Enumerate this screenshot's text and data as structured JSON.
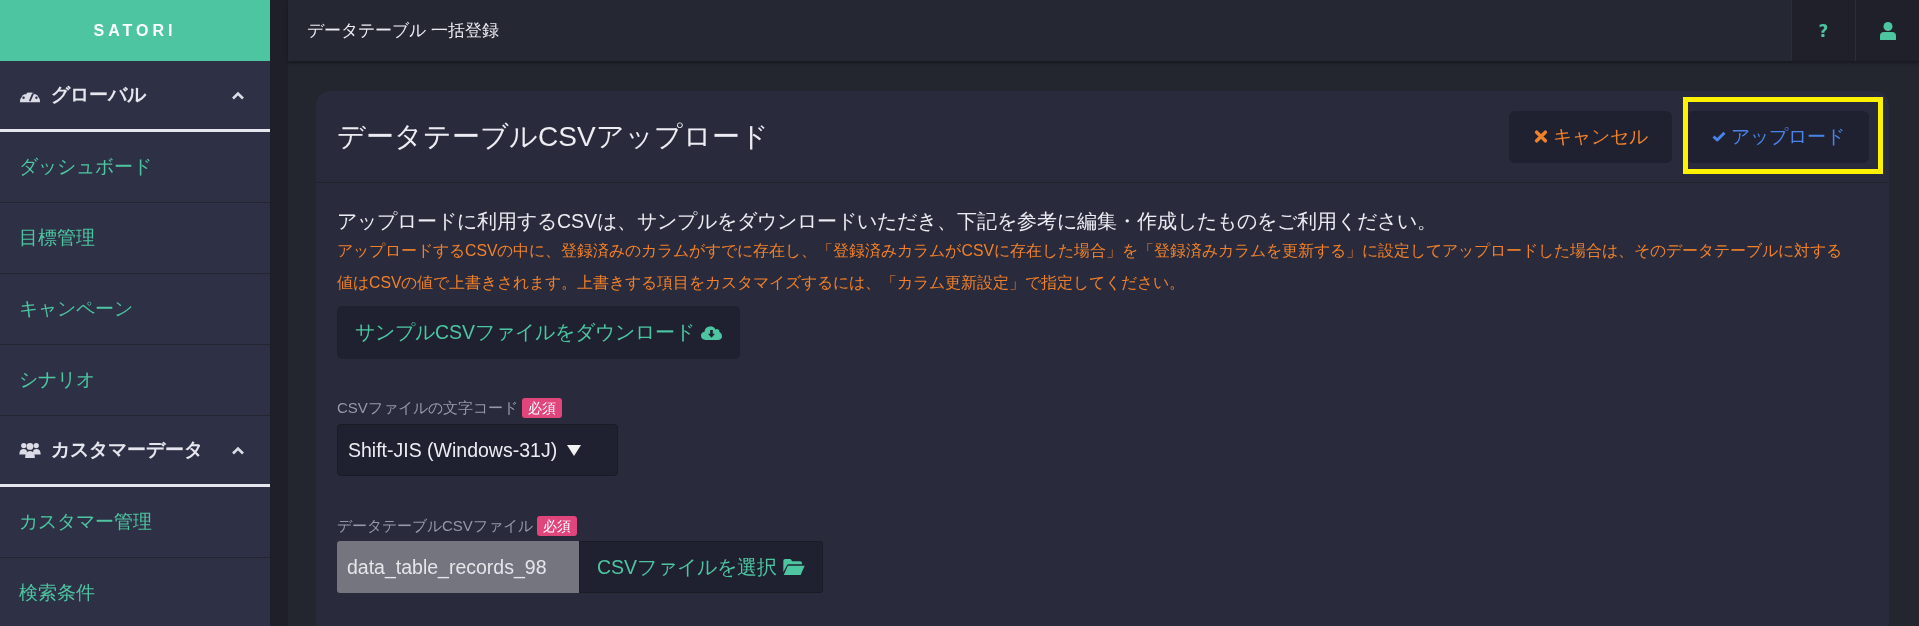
{
  "sidebar": {
    "logo": "SATORI",
    "sections": [
      {
        "label": "グローバル",
        "expanded": true,
        "items": [
          {
            "label": "ダッシュボード",
            "selected": false
          },
          {
            "label": "目標管理",
            "selected": false
          },
          {
            "label": "キャンペーン",
            "selected": false
          },
          {
            "label": "シナリオ",
            "selected": false
          }
        ]
      },
      {
        "label": "カスタマーデータ",
        "expanded": true,
        "items": [
          {
            "label": "カスタマー管理",
            "selected": false
          },
          {
            "label": "検索条件",
            "selected": false
          }
        ]
      }
    ]
  },
  "header": {
    "title": "データテーブル 一括登録",
    "help_button": "?"
  },
  "card": {
    "title": "データテーブルCSVアップロード",
    "buttons": [
      {
        "kind": "cancel",
        "label": "キャンセル",
        "highlighted": false
      },
      {
        "kind": "upload",
        "label": "アップロード",
        "highlighted": true
      }
    ],
    "intro": "アップロードに利用するCSVは、サンプルをダウンロードいただき、下記を参考に編集・作成したものをご利用ください。",
    "notice": "アップロードするCSVの中に、登録済みのカラムがすでに存在し、「登録済みカラムがCSVに存在した場合」を「登録済みカラムを更新する」に設定してアップロードした場合は、そのデータテーブルに対する値はCSVの値で上書きされます。上書きする項目をカスタマイズするには、「カラム更新設定」で指定してください。",
    "download_button": "サンプルCSVファイルをダウンロード",
    "fields": [
      {
        "kind": "select",
        "label": "CSVファイルの文字コード",
        "badge": "必須",
        "value": "Shift-JIS (Windows-31J)"
      },
      {
        "kind": "file",
        "label": "データテーブルCSVファイル",
        "badge": "必須",
        "value": "data_table_records_98",
        "button": "CSVファイルを選択"
      }
    ]
  }
}
